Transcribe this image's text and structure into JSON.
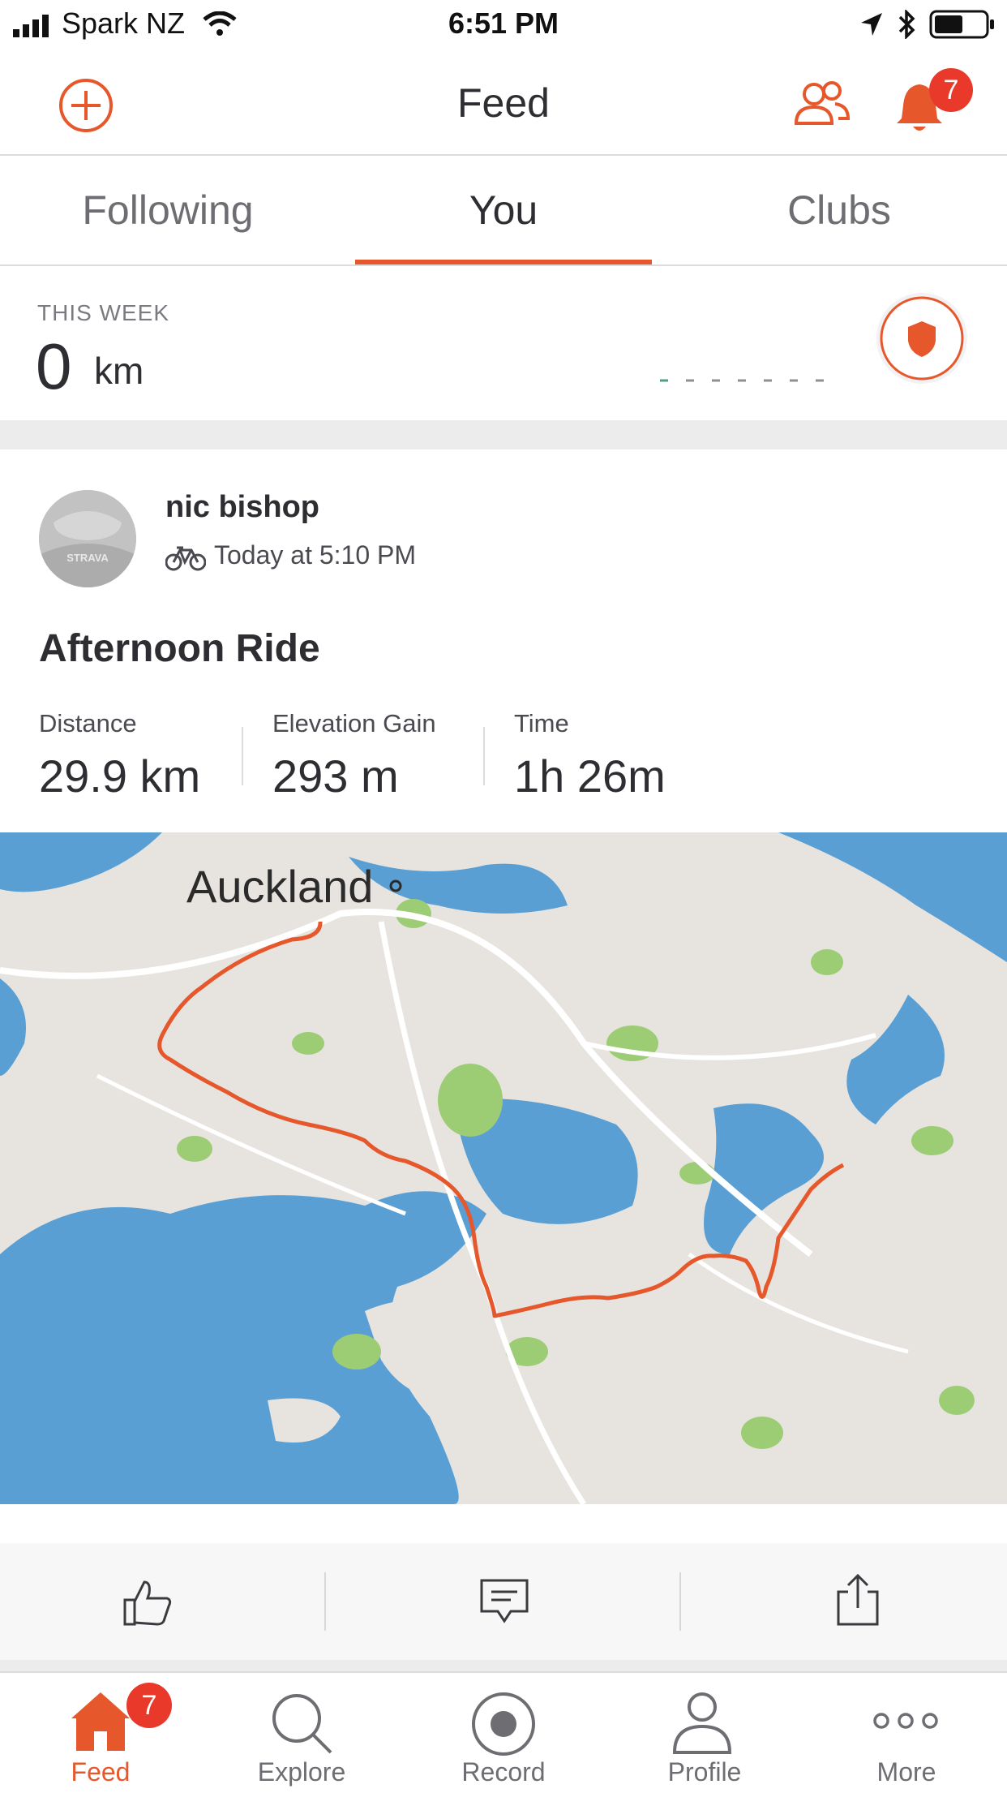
{
  "status_bar": {
    "carrier": "Spark NZ",
    "time": "6:51 PM"
  },
  "header": {
    "title": "Feed",
    "notification_count": "7"
  },
  "tabs": [
    {
      "label": "Following",
      "active": false
    },
    {
      "label": "You",
      "active": true
    },
    {
      "label": "Clubs",
      "active": false
    }
  ],
  "this_week": {
    "label": "THIS WEEK",
    "distance": "0",
    "unit": "km"
  },
  "activity": {
    "athlete": "nic bishop",
    "avatar_text": "STRAVA",
    "time": "Today at 5:10 PM",
    "title": "Afternoon Ride",
    "stats": [
      {
        "label": "Distance",
        "value": "29.9 km"
      },
      {
        "label": "Elevation Gain",
        "value": "293 m"
      },
      {
        "label": "Time",
        "value": "1h 26m"
      }
    ],
    "map_label": "Auckland"
  },
  "bottom_nav": {
    "badge": "7",
    "items": [
      {
        "label": "Feed",
        "icon": "home-icon",
        "active": true
      },
      {
        "label": "Explore",
        "icon": "search-icon",
        "active": false
      },
      {
        "label": "Record",
        "icon": "record-icon",
        "active": false
      },
      {
        "label": "Profile",
        "icon": "profile-icon",
        "active": false
      },
      {
        "label": "More",
        "icon": "more-icon",
        "active": false
      }
    ]
  },
  "colors": {
    "accent": "#e6582b",
    "badge": "#e8392b",
    "water": "#5a9fd4",
    "land": "#e7e4df",
    "park": "#9ccc74"
  }
}
